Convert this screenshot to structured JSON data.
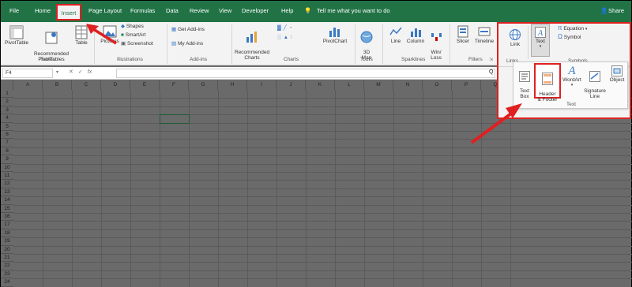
{
  "tabs": [
    "File",
    "Home",
    "Insert",
    "Page Layout",
    "Formulas",
    "Data",
    "Review",
    "View",
    "Developer",
    "Help"
  ],
  "tellme": "Tell me what you want to do",
  "share": "Share",
  "ribbon": {
    "tables": {
      "pivottable": "PivotTable",
      "recommended": "Recommended\nPivotTables",
      "table": "Table",
      "label": "Tables"
    },
    "illustrations": {
      "pictures": "Pictures",
      "shapes": "Shapes",
      "smartart": "SmartArt",
      "screenshot": "Screenshot",
      "label": "Illustrations"
    },
    "addins": {
      "get": "Get Add-ins",
      "my": "My Add-ins",
      "label": "Add-ins"
    },
    "charts": {
      "recommended": "Recommended\nCharts",
      "pivotchart": "PivotChart",
      "label": "Charts"
    },
    "tours": {
      "map": "3D\nMap",
      "label": "Tours"
    },
    "sparklines": {
      "line": "Line",
      "column": "Column",
      "winloss": "Win/\nLoss",
      "label": "Sparklines"
    },
    "filters": {
      "slicer": "Slicer",
      "timeline": "Timeline",
      "label": "Filters"
    },
    "links": {
      "link": "Link",
      "label": "Links"
    },
    "text": {
      "text": "Text",
      "label": "Text"
    },
    "symbols": {
      "equation": "Equation",
      "symbol": "Symbol",
      "label": "Symbols"
    }
  },
  "popup": {
    "textbox": "Text\nBox",
    "headerfooter": "Header\n& Footer",
    "wordart": "WordArt",
    "signature": "Signature\nLine",
    "object": "Object",
    "label": "Text"
  },
  "namebox": "F4",
  "columns": [
    "A",
    "B",
    "C",
    "D",
    "E",
    "F",
    "G",
    "H",
    "I",
    "J",
    "K",
    "L",
    "M",
    "N",
    "O",
    "P",
    "Q"
  ],
  "rows": [
    "1",
    "2",
    "3",
    "4",
    "5",
    "6",
    "7",
    "8",
    "9",
    "10",
    "11",
    "12",
    "13",
    "14",
    "15",
    "16",
    "17",
    "18",
    "19",
    "20",
    "21",
    "22",
    "23",
    "24"
  ],
  "colors": {
    "excel_green": "#217346",
    "annotation_red": "#e02020"
  }
}
